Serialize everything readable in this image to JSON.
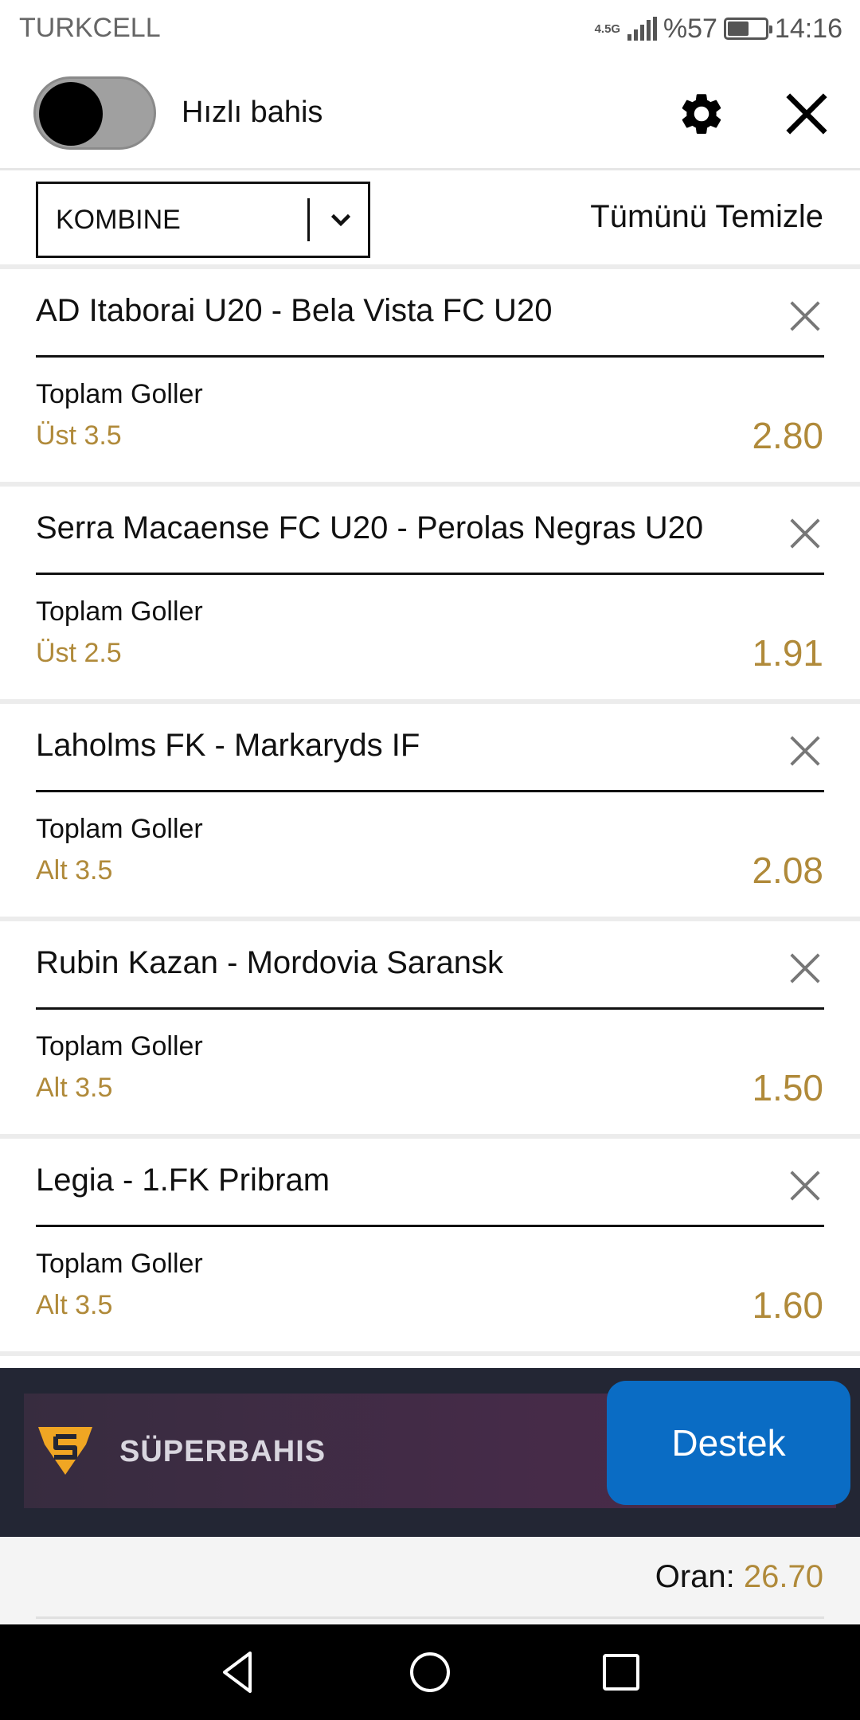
{
  "status_bar": {
    "carrier": "TURKCELL",
    "network": "4.5G",
    "battery": "%57",
    "battery_level": 0.57,
    "time": "14:16"
  },
  "top_bar": {
    "quick_bet_label": "Hızlı bahis",
    "quick_bet_enabled": false,
    "icons": [
      "gear-icon",
      "close-icon"
    ]
  },
  "toolbar": {
    "bet_type": "KOMBINE",
    "clear_all": "Tümünü Temizle"
  },
  "bets": [
    {
      "match": "AD Itaborai U20 - Bela Vista FC U20",
      "market": "Toplam Goller",
      "selection": "Üst 3.5",
      "odds": "2.80"
    },
    {
      "match": "Serra Macaense FC U20 - Perolas Negras U20",
      "market": "Toplam Goller",
      "selection": "Üst 2.5",
      "odds": "1.91"
    },
    {
      "match": "Laholms FK - Markaryds IF",
      "market": "Toplam Goller",
      "selection": "Alt 3.5",
      "odds": "2.08"
    },
    {
      "match": "Rubin Kazan - Mordovia Saransk",
      "market": "Toplam Goller",
      "selection": "Alt 3.5",
      "odds": "1.50"
    },
    {
      "match": "Legia - 1.FK Pribram",
      "market": "Toplam Goller",
      "selection": "Alt 3.5",
      "odds": "1.60"
    }
  ],
  "banner": {
    "brand": "SÜPERBAHIS"
  },
  "support": {
    "label": "Destek"
  },
  "total": {
    "label": "Oran:",
    "value": "26.70"
  },
  "colors": {
    "accent_gold": "#b08a3a",
    "support_blue": "#0a6cc4",
    "banner_dark": "#232634"
  }
}
